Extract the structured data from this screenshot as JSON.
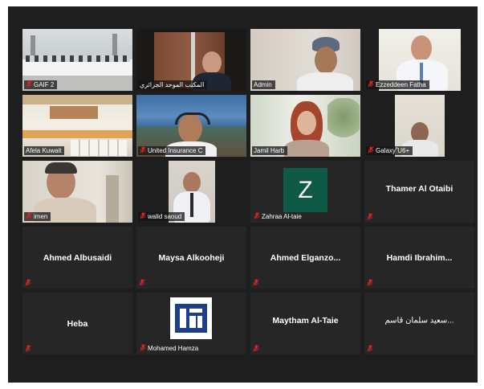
{
  "participants": [
    {
      "name": "GAIF 2",
      "muted": true
    },
    {
      "name": "المكتب الموحد الجزائري",
      "muted": false
    },
    {
      "name": "Admin",
      "muted": false
    },
    {
      "name": "Ezzeddeen Fatha",
      "muted": true
    },
    {
      "name": "Afela Kuwait",
      "muted": true
    },
    {
      "name": "United Insurance C",
      "muted": true
    },
    {
      "name": "Jamil Harb",
      "muted": false
    },
    {
      "name": "Galaxy ٌU6+",
      "muted": true
    },
    {
      "name": "imen",
      "muted": true
    },
    {
      "name": "walid saoud",
      "muted": true
    },
    {
      "name": "Zahraa Al-taie",
      "muted": true,
      "avatar_letter": "Z"
    },
    {
      "name": "Thamer Al Otaibi",
      "muted": true
    },
    {
      "name": "Ahmed Albusaidi",
      "muted": true
    },
    {
      "name": "Maysa Alkooheji",
      "muted": true
    },
    {
      "name": "Ahmed  Elganzo...",
      "muted": true
    },
    {
      "name": "Hamdi  Ibrahim...",
      "muted": true
    },
    {
      "name": "Heba",
      "muted": true
    },
    {
      "name": "Mohamed Hamza",
      "muted": true
    },
    {
      "name": "Maytham Al-Taie",
      "muted": true
    },
    {
      "name": "سعيد سلمان قاسم...",
      "muted": true
    }
  ],
  "colors": {
    "background": "#1e1e1e",
    "tile": "#262626",
    "avatar_green": "#0e5a47",
    "mute_red": "#e02424",
    "logo_blue": "#1f3e8a"
  },
  "icons": {
    "muted": "microphone-muted-icon"
  }
}
